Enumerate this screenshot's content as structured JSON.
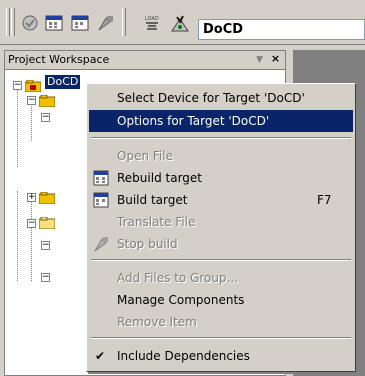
{
  "toolbar": {
    "target_name": "DoCD",
    "icons": [
      "compile-icon",
      "rebuild-icon",
      "build-icon",
      "stop-build-icon",
      "load-icon",
      "target-options-icon"
    ]
  },
  "workspace": {
    "title": "Project Workspace",
    "root_label": "DoCD"
  },
  "context_menu": {
    "items": [
      {
        "label": "Select Device for Target 'DoCD'",
        "state": "enabled"
      },
      {
        "label": "Options for Target 'DoCD'",
        "state": "selected"
      },
      {
        "label": "Open File",
        "state": "disabled"
      },
      {
        "label": "Rebuild target",
        "state": "enabled",
        "icon": "rebuild-icon"
      },
      {
        "label": "Build target",
        "shortcut": "F7",
        "state": "enabled",
        "icon": "build-icon"
      },
      {
        "label": "Translate File",
        "state": "disabled"
      },
      {
        "label": "Stop build",
        "state": "disabled",
        "icon": "stop-build-icon"
      },
      {
        "label": "Add Files to Group...",
        "state": "disabled"
      },
      {
        "label": "Manage Components",
        "state": "enabled"
      },
      {
        "label": "Remove Item",
        "state": "disabled"
      },
      {
        "label": "Include Dependencies",
        "state": "checked"
      }
    ]
  },
  "colors": {
    "face": "#d4d0c8",
    "highlight": "#0a246a",
    "disabled_text": "#808080"
  }
}
